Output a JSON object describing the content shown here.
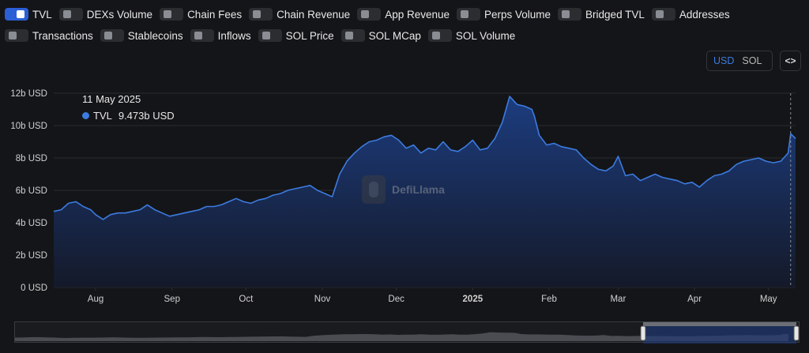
{
  "toggles": [
    [
      {
        "label": "TVL",
        "on": true
      },
      {
        "label": "DEXs Volume",
        "on": false
      },
      {
        "label": "Chain Fees",
        "on": false
      },
      {
        "label": "Chain Revenue",
        "on": false
      },
      {
        "label": "App Revenue",
        "on": false
      },
      {
        "label": "Perps Volume",
        "on": false
      },
      {
        "label": "Bridged TVL",
        "on": false
      },
      {
        "label": "Addresses",
        "on": false
      }
    ],
    [
      {
        "label": "Transactions",
        "on": false
      },
      {
        "label": "Stablecoins",
        "on": false
      },
      {
        "label": "Inflows",
        "on": false
      },
      {
        "label": "SOL Price",
        "on": false
      },
      {
        "label": "SOL MCap",
        "on": false
      },
      {
        "label": "SOL Volume",
        "on": false
      }
    ]
  ],
  "unit_toggle": {
    "usd": "USD",
    "sol": "SOL",
    "selected": "USD"
  },
  "embed_label": "<>",
  "tooltip": {
    "date": "11 May 2025",
    "series": "TVL",
    "value": "9.473b USD"
  },
  "watermark": "DefiLlama",
  "colors": {
    "line": "#3c7be0",
    "fill_top": "#1d3f85",
    "fill_bottom": "#141a2b",
    "grid": "#2a2c30",
    "axis_text": "#d0d0d0"
  },
  "chart_data": {
    "type": "area",
    "series": [
      {
        "name": "TVL"
      }
    ],
    "ylim": [
      0,
      12
    ],
    "yticks": [
      "0 USD",
      "2b USD",
      "4b USD",
      "6b USD",
      "8b USD",
      "10b USD",
      "12b USD"
    ],
    "xticks": [
      {
        "label": "Aug",
        "day": 0,
        "bold": false
      },
      {
        "label": "Sep",
        "day": 31,
        "bold": false
      },
      {
        "label": "Oct",
        "day": 61,
        "bold": false
      },
      {
        "label": "Nov",
        "day": 92,
        "bold": false
      },
      {
        "label": "Dec",
        "day": 122,
        "bold": false
      },
      {
        "label": "2025",
        "day": 153,
        "bold": true
      },
      {
        "label": "Feb",
        "day": 184,
        "bold": false
      },
      {
        "label": "Mar",
        "day": 212,
        "bold": false
      },
      {
        "label": "Apr",
        "day": 243,
        "bold": false
      },
      {
        "label": "May",
        "day": 273,
        "bold": false
      }
    ],
    "x": [
      -17,
      -14,
      -11,
      -8,
      -5,
      -2,
      0,
      3,
      6,
      9,
      12,
      15,
      18,
      21,
      24,
      27,
      30,
      33,
      36,
      39,
      42,
      45,
      48,
      51,
      54,
      57,
      60,
      63,
      66,
      69,
      72,
      75,
      78,
      81,
      84,
      87,
      90,
      93,
      96,
      99,
      102,
      105,
      108,
      111,
      114,
      117,
      120,
      123,
      126,
      129,
      132,
      135,
      138,
      141,
      144,
      147,
      150,
      153,
      156,
      159,
      162,
      165,
      168,
      171,
      174,
      177,
      178,
      180,
      183,
      186,
      189,
      192,
      195,
      198,
      201,
      204,
      207,
      210,
      212,
      215,
      218,
      221,
      224,
      227,
      230,
      233,
      236,
      239,
      242,
      245,
      248,
      251,
      254,
      257,
      260,
      263,
      266,
      269,
      272,
      275,
      278,
      281,
      282,
      284
    ],
    "values": [
      4.7,
      4.8,
      5.2,
      5.3,
      5.0,
      4.8,
      4.5,
      4.2,
      4.5,
      4.6,
      4.6,
      4.7,
      4.8,
      5.1,
      4.8,
      4.6,
      4.4,
      4.5,
      4.6,
      4.7,
      4.8,
      5.0,
      5.0,
      5.1,
      5.3,
      5.5,
      5.3,
      5.2,
      5.4,
      5.5,
      5.7,
      5.8,
      6.0,
      6.1,
      6.2,
      6.3,
      6.0,
      5.8,
      5.6,
      7.0,
      7.8,
      8.3,
      8.7,
      9.0,
      9.1,
      9.3,
      9.4,
      9.1,
      8.6,
      8.8,
      8.3,
      8.6,
      8.5,
      9.0,
      8.5,
      8.4,
      8.7,
      9.1,
      8.5,
      8.6,
      9.2,
      10.2,
      11.8,
      11.3,
      11.2,
      11.0,
      10.6,
      9.4,
      8.8,
      8.9,
      8.7,
      8.6,
      8.5,
      8.0,
      7.6,
      7.3,
      7.2,
      7.5,
      8.1,
      6.9,
      7.0,
      6.6,
      6.8,
      7.0,
      6.8,
      6.7,
      6.6,
      6.4,
      6.5,
      6.2,
      6.6,
      6.9,
      7.0,
      7.2,
      7.6,
      7.8,
      7.9,
      8.0,
      7.8,
      7.7,
      7.8,
      8.3,
      9.5,
      9.2
    ]
  }
}
